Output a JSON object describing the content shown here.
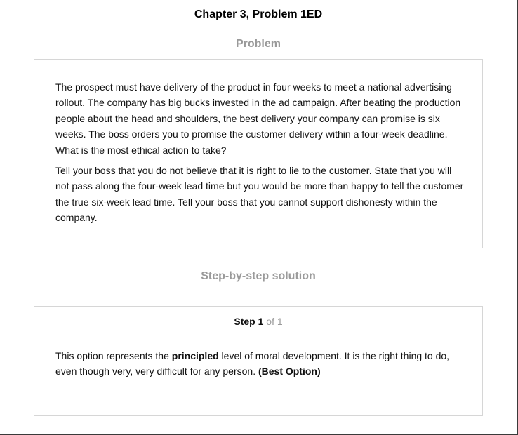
{
  "page": {
    "title": "Chapter 3, Problem 1ED"
  },
  "problem": {
    "heading": "Problem",
    "paragraphs": [
      "The prospect must have delivery of the product in four weeks to meet a national advertising rollout. The company has big bucks invested in the ad campaign. After beating the production people about the head and shoulders, the best delivery your company can promise is six weeks. The boss orders you to promise the customer delivery within a four-week deadline. What is the most ethical action to take?",
      "Tell your boss that you do not believe that it is right to lie to the customer. State that you will not pass along the four-week lead time but you would be more than happy to tell the customer the true six-week lead time. Tell your boss that you cannot support dishonesty within the company."
    ]
  },
  "solution": {
    "heading": "Step-by-step solution",
    "step_word": "Step",
    "step_number": "1",
    "step_of": "of 1",
    "text_before": "This option represents the ",
    "text_bold": "principled",
    "text_after": " level of moral development. It is the right thing to do, even though very, very difficult for any person. ",
    "text_tag": "(Best Option)"
  }
}
